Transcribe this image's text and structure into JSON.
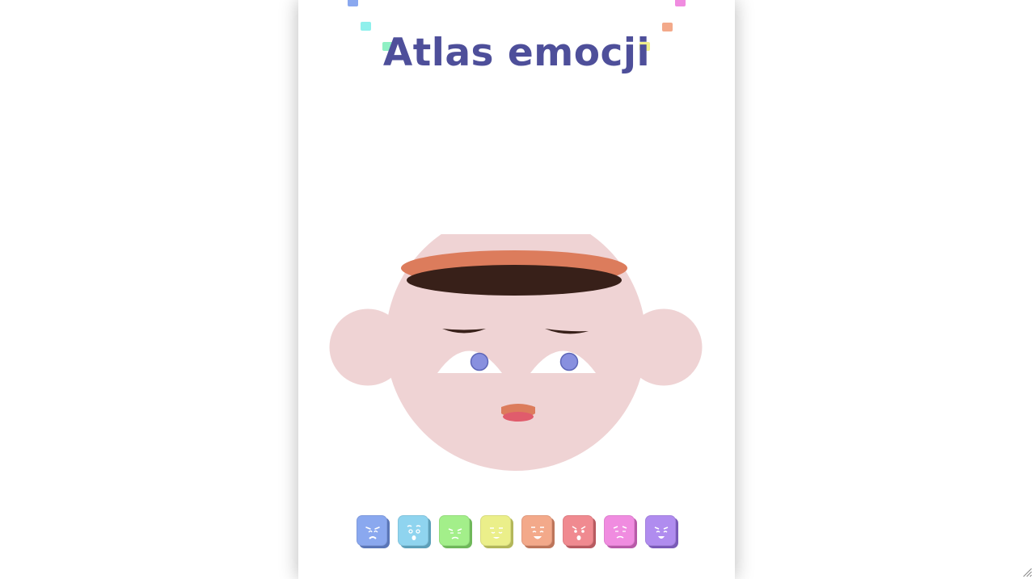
{
  "app": {
    "title": "Atlas emocji",
    "title_color": "#4e4f9a"
  },
  "confetti_colors": [
    "#8aa8ef",
    "#8ff0ec",
    "#8ff0c4",
    "#f1f08c",
    "#f3a98a",
    "#f08ce0"
  ],
  "face": {
    "skin_color": "#efd3d4",
    "hair_color": "#382019",
    "hair_rim_color": "#dc7c5c",
    "eyebrow_color": "#382019",
    "eye_white_color": "#ffffff",
    "iris_color": "#8890df",
    "iris_stroke_color": "#5d66b8",
    "mouth_color": "#dc7c5c",
    "tongue_color": "#e05c6c"
  },
  "emotions": [
    {
      "name": "sadness",
      "color": "#8aa8ef"
    },
    {
      "name": "surprise",
      "color": "#8fd4ef"
    },
    {
      "name": "disgust",
      "color": "#a3ef8a"
    },
    {
      "name": "calm",
      "color": "#ebef8a"
    },
    {
      "name": "joy",
      "color": "#f3a98a"
    },
    {
      "name": "anger",
      "color": "#f08a90"
    },
    {
      "name": "shame",
      "color": "#f08ce0"
    },
    {
      "name": "pride",
      "color": "#b08cef"
    }
  ]
}
